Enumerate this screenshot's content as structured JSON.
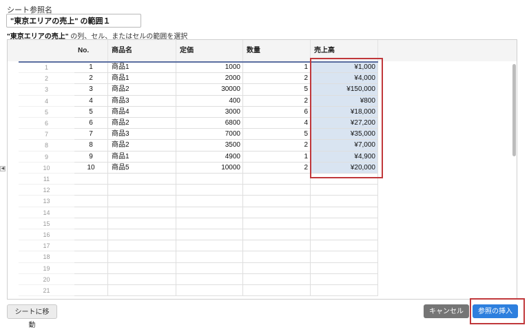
{
  "form": {
    "label": "シート参照名",
    "name_value": "\"東京エリアの売上\" の範囲１",
    "instruction_bold": "\"東京エリアの売上\"",
    "instruction_rest": " の列、セル、またはセルの範囲を選択"
  },
  "sheet": {
    "headers": [
      "No.",
      "商品名",
      "定価",
      "数量",
      "売上高"
    ],
    "rows": [
      {
        "n": "1",
        "cells": [
          "1",
          "商品1",
          "1000",
          "1",
          "¥1,000"
        ]
      },
      {
        "n": "2",
        "cells": [
          "2",
          "商品1",
          "2000",
          "2",
          "¥4,000"
        ]
      },
      {
        "n": "3",
        "cells": [
          "3",
          "商品2",
          "30000",
          "5",
          "¥150,000"
        ]
      },
      {
        "n": "4",
        "cells": [
          "4",
          "商品3",
          "400",
          "2",
          "¥800"
        ]
      },
      {
        "n": "5",
        "cells": [
          "5",
          "商品4",
          "3000",
          "6",
          "¥18,000"
        ]
      },
      {
        "n": "6",
        "cells": [
          "6",
          "商品2",
          "6800",
          "4",
          "¥27,200"
        ]
      },
      {
        "n": "7",
        "cells": [
          "7",
          "商品3",
          "7000",
          "5",
          "¥35,000"
        ]
      },
      {
        "n": "8",
        "cells": [
          "8",
          "商品2",
          "3500",
          "2",
          "¥7,000"
        ]
      },
      {
        "n": "9",
        "cells": [
          "9",
          "商品1",
          "4900",
          "1",
          "¥4,900"
        ]
      },
      {
        "n": "10",
        "cells": [
          "10",
          "商品5",
          "10000",
          "2",
          "¥20,000"
        ]
      },
      {
        "n": "11",
        "cells": [
          "",
          "",
          "",
          "",
          ""
        ]
      },
      {
        "n": "12",
        "cells": [
          "",
          "",
          "",
          "",
          ""
        ]
      },
      {
        "n": "13",
        "cells": [
          "",
          "",
          "",
          "",
          ""
        ]
      },
      {
        "n": "14",
        "cells": [
          "",
          "",
          "",
          "",
          ""
        ]
      },
      {
        "n": "15",
        "cells": [
          "",
          "",
          "",
          "",
          ""
        ]
      },
      {
        "n": "16",
        "cells": [
          "",
          "",
          "",
          "",
          ""
        ]
      },
      {
        "n": "17",
        "cells": [
          "",
          "",
          "",
          "",
          ""
        ]
      },
      {
        "n": "18",
        "cells": [
          "",
          "",
          "",
          "",
          ""
        ]
      },
      {
        "n": "19",
        "cells": [
          "",
          "",
          "",
          "",
          ""
        ]
      },
      {
        "n": "20",
        "cells": [
          "",
          "",
          "",
          "",
          ""
        ]
      },
      {
        "n": "21",
        "cells": [
          "",
          "",
          "",
          "",
          ""
        ]
      }
    ],
    "selected_column": 4,
    "selected_rows": 10
  },
  "buttons": {
    "move_to_sheet": "シートに移動",
    "cancel": "キャンセル",
    "insert_reference": "参照の挿入"
  },
  "colors": {
    "highlight": "#c0373a",
    "selection": "#d9e4f1",
    "primary": "#2d7fde"
  }
}
